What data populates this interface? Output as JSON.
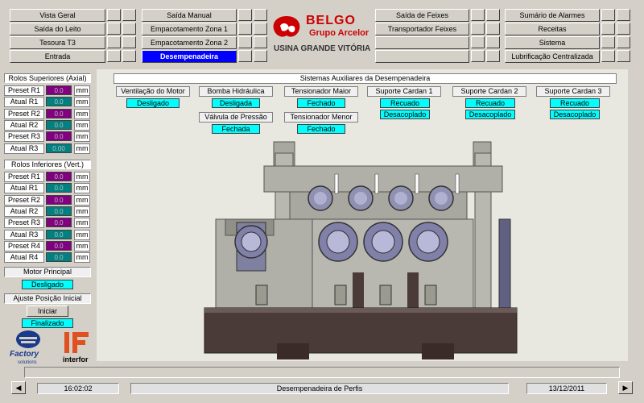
{
  "nav": {
    "col1": [
      "Vista Geral",
      "Saída do Leito",
      "Tesoura T3",
      "Entrada"
    ],
    "col2": [
      "Saída Manual",
      "Empacotamento Zona 1",
      "Empacotamento Zona 2",
      "Desempenadeira"
    ],
    "col3": [
      "Saída de Feixes",
      "Transportador Feixes",
      "",
      ""
    ],
    "col4": [
      "Sumário de Alarmes",
      "Receitas",
      "Sistema",
      "Lubrificação Centralizada"
    ]
  },
  "logo": {
    "brand": "BELGO",
    "group": "Grupo Arcelor",
    "plant": "USINA GRANDE VITÓRIA"
  },
  "upper_rolls": {
    "title": "Rolos Superiores (Axial)",
    "rows": [
      {
        "label": "Preset R1",
        "value": "0.0",
        "kind": "preset",
        "unit": "mm"
      },
      {
        "label": "Atual R1",
        "value": "0.0",
        "kind": "actual",
        "unit": "mm"
      },
      {
        "label": "Preset R2",
        "value": "0.0",
        "kind": "preset",
        "unit": "mm"
      },
      {
        "label": "Atual R2",
        "value": "0.0",
        "kind": "actual",
        "unit": "mm"
      },
      {
        "label": "Preset R3",
        "value": "0.0",
        "kind": "preset",
        "unit": "mm"
      },
      {
        "label": "Atual R3",
        "value": "0.00",
        "kind": "actual",
        "unit": "mm"
      }
    ]
  },
  "lower_rolls": {
    "title": "Rolos Inferiores (Vert.)",
    "rows": [
      {
        "label": "Preset R1",
        "value": "0.0",
        "kind": "preset",
        "unit": "mm"
      },
      {
        "label": "Atual R1",
        "value": "0.0",
        "kind": "actual",
        "unit": "mm"
      },
      {
        "label": "Preset R2",
        "value": "0.0",
        "kind": "preset",
        "unit": "mm"
      },
      {
        "label": "Atual R2",
        "value": "0.0",
        "kind": "actual",
        "unit": "mm"
      },
      {
        "label": "Preset R3",
        "value": "0.0",
        "kind": "preset",
        "unit": "mm"
      },
      {
        "label": "Atual R3",
        "value": "0.0",
        "kind": "actual",
        "unit": "mm"
      },
      {
        "label": "Preset R4",
        "value": "0.0",
        "kind": "preset",
        "unit": "mm"
      },
      {
        "label": "Atual R4",
        "value": "0.0",
        "kind": "actual",
        "unit": "mm"
      }
    ]
  },
  "motor": {
    "title": "Motor Principal",
    "status": "Desligado"
  },
  "position": {
    "title": "Ajuste Posição Inicial",
    "button": "Iniciar",
    "status": "Finalizado"
  },
  "brands": {
    "factory": "Factory",
    "factory_sub": "solutions",
    "interfor": "interfor"
  },
  "aux": {
    "title": "Sistemas Auxiliares da Desempenadeira",
    "ventilacao": {
      "label": "Ventilação do Motor",
      "status": "Desligado"
    },
    "bomba": {
      "label": "Bomba Hidráulica",
      "status": "Desligada"
    },
    "valvula": {
      "label": "Válvula de Pressão",
      "status": "Fechada"
    },
    "tens_maior": {
      "label": "Tensionador Maior",
      "status": "Fechado"
    },
    "tens_menor": {
      "label": "Tensionador Menor",
      "status": "Fechado"
    },
    "cardan1": {
      "label": "Suporte Cardan 1",
      "status1": "Recuado",
      "status2": "Desacoplado"
    },
    "cardan2": {
      "label": "Suporte Cardan 2",
      "status1": "Recuado",
      "status2": "Desacoplado"
    },
    "cardan3": {
      "label": "Suporte Cardan 3",
      "status1": "Recuado",
      "status2": "Desacoplado"
    }
  },
  "status_bar": {
    "time": "16:02:02",
    "screen": "Desempenadeira de Perfis",
    "date": "13/12/2011"
  },
  "colors": {
    "preset": "#800080",
    "actual": "#008080",
    "status_ok": "#00ffff",
    "selected": "#0000ff",
    "brand_red": "#cc0000"
  }
}
